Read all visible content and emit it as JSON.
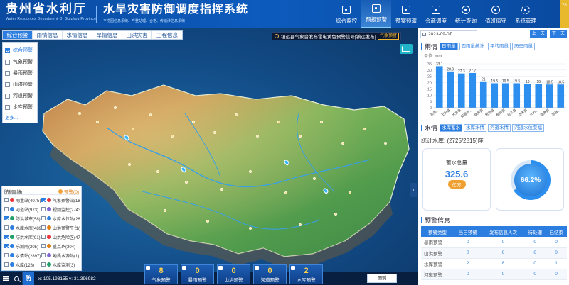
{
  "header": {
    "org_title": "贵州省水利厅",
    "org_subtitle": "Water Resources Department Of Guizhou Province",
    "system_title": "水旱灾害防御调度指挥系统",
    "system_subtitle": "平涝图信息系统、产整站理、合格、传输涉信息系统",
    "nav": [
      {
        "label": "综合监控",
        "active": false
      },
      {
        "label": "预报预警",
        "active": true
      },
      {
        "label": "预案预演",
        "active": false
      },
      {
        "label": "会商调度",
        "active": false
      },
      {
        "label": "统计查询",
        "active": false
      },
      {
        "label": "值班值守",
        "active": false
      },
      {
        "label": "系统管理",
        "active": false
      }
    ],
    "weather": "76"
  },
  "map": {
    "tabs": [
      {
        "label": "综合预警",
        "active": true
      },
      {
        "label": "雨情信息",
        "active": false
      },
      {
        "label": "水情信息",
        "active": false
      },
      {
        "label": "旱情信息",
        "active": false
      },
      {
        "label": "山洪灾害",
        "active": false
      },
      {
        "label": "工程信息",
        "active": false
      }
    ],
    "layers": [
      {
        "label": "综合预警",
        "checked": true
      },
      {
        "label": "气象预警",
        "checked": false
      },
      {
        "label": "暴雨预警",
        "checked": false
      },
      {
        "label": "山洪预警",
        "checked": false
      },
      {
        "label": "河道预警",
        "checked": false
      },
      {
        "label": "水库预警",
        "checked": false
      }
    ],
    "more_label": "更多...",
    "alert_text": "镇远县气象台发布雷电黄色预警信号[镇远发布]",
    "alert_button": "气象预警",
    "legend": {
      "title": "防御对象",
      "warn_label": "预警(0)",
      "items": [
        {
          "label": "雨量站(4075)",
          "color": "#e8383d",
          "checked": false
        },
        {
          "label": "气象预警站(1811)",
          "color": "#e8383d",
          "checked": true
        },
        {
          "label": "河道站(973)",
          "color": "#2c7de0",
          "checked": false
        },
        {
          "label": "视频监控(2743)",
          "color": "#7f66d6",
          "checked": false
        },
        {
          "label": "防洪城市(58)",
          "color": "#22a06b",
          "checked": true
        },
        {
          "label": "水库水位站(2615)",
          "color": "#2c7de0",
          "checked": false
        },
        {
          "label": "水库水库(489)",
          "color": "#2c7de0",
          "checked": false
        },
        {
          "label": "山洪预警平台(363)",
          "color": "#e07d11",
          "checked": false
        },
        {
          "label": "防洪水库(91)",
          "color": "#22a06b",
          "checked": true
        },
        {
          "label": "山洪危险区(4737)",
          "color": "#e8383d",
          "checked": false
        },
        {
          "label": "乐测雨(205)",
          "color": "#2c7de0",
          "checked": true
        },
        {
          "label": "重点乡(304)",
          "color": "#e07d11",
          "checked": false
        },
        {
          "label": "水情站(2897)",
          "color": "#2c7de0",
          "checked": false
        },
        {
          "label": "地质水源站(1)",
          "color": "#7f66d6",
          "checked": false
        },
        {
          "label": "水库(128)",
          "color": "#2c7de0",
          "checked": false
        },
        {
          "label": "水库监测(3)",
          "color": "#22a06b",
          "checked": false
        }
      ]
    },
    "coords": "x: 105.193155  y: 31.396982",
    "fang_label": "防",
    "cards": [
      {
        "value": "8",
        "label": "气象预警"
      },
      {
        "value": "0",
        "label": "暴雨预警"
      },
      {
        "value": "0",
        "label": "山洪预警"
      },
      {
        "value": "0",
        "label": "河道预警"
      },
      {
        "value": "2",
        "label": "水库预警"
      }
    ],
    "legend_button": "图例",
    "collapse_arrow": "›"
  },
  "right_panel": {
    "date": "2023-09-07",
    "prev_label": "上一天",
    "next_label": "下一天",
    "rain": {
      "title": "雨情",
      "tabs": [
        {
          "label": "日雨量",
          "active": true
        },
        {
          "label": "面雨量统计",
          "active": false
        },
        {
          "label": "平均雨量",
          "active": false
        },
        {
          "label": "历史雨量",
          "active": false
        }
      ],
      "unit": "单位: mm"
    },
    "water": {
      "title": "水情",
      "tabs": [
        {
          "label": "水库蓄水",
          "active": true
        },
        {
          "label": "水库水情",
          "active": false
        },
        {
          "label": "河道水情",
          "active": false
        },
        {
          "label": "河道水位变幅",
          "active": false
        }
      ],
      "summary": "统计水库: (2725/2815)座",
      "storage_title": "蓄水总量",
      "storage_value": "325.6",
      "storage_unit": "亿方",
      "ratio_value": "66.2%",
      "ratio": 0.662
    },
    "warning": {
      "title": "预警信息",
      "columns": [
        "预警类型",
        "当日预警",
        "发布信息人次",
        "待处理",
        "已结束"
      ],
      "rows": [
        {
          "type": "暴雨预警",
          "today": "0",
          "published": "0",
          "pending": "0",
          "done": "0"
        },
        {
          "type": "山洪预警",
          "today": "0",
          "published": "0",
          "pending": "0",
          "done": "0"
        },
        {
          "type": "水库预警",
          "today": "2",
          "published": "8",
          "pending": "0",
          "done": "1"
        },
        {
          "type": "河道预警",
          "today": "0",
          "published": "0",
          "pending": "0",
          "done": "0"
        }
      ]
    }
  },
  "chart_data": {
    "type": "bar",
    "categories": [
      "凯里...",
      "正安县",
      "大方县",
      "安顺市...",
      "锦屏县",
      "思南县",
      "桐梓县",
      "台江县",
      "贞丰县",
      "大方...",
      "纳雍县",
      "荔波..."
    ],
    "values": [
      33.1,
      28.9,
      27.3,
      27.7,
      21.0,
      19.5,
      19.5,
      19.5,
      19.0,
      19.0,
      18.5,
      18.5
    ],
    "ylim": [
      0,
      35
    ],
    "yticks": [
      0,
      5,
      10,
      15,
      20,
      25,
      30,
      35
    ],
    "color": "#2c8ff0"
  }
}
